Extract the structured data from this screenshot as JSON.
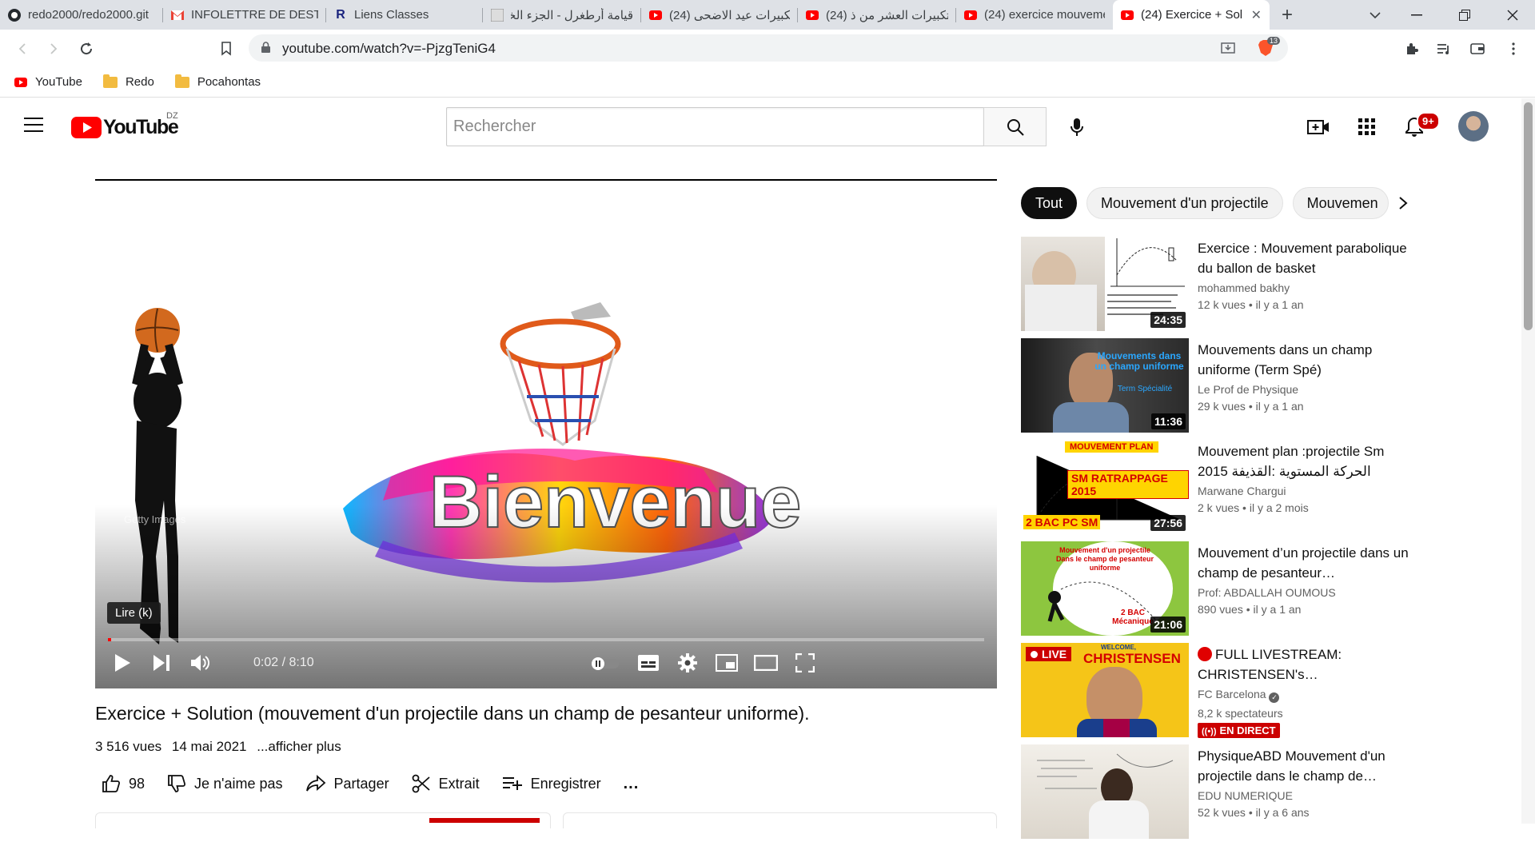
{
  "browser": {
    "tabs": [
      {
        "title": "redo2000/redo2000.git",
        "icon": "github-icon"
      },
      {
        "title": "INFOLETTRE DE DESTIN",
        "icon": "gmail-icon"
      },
      {
        "title": "Liens Classes",
        "icon": "r-icon"
      },
      {
        "title": "قيامة أرطغرل - الجزء الخا",
        "icon": "site-icon"
      },
      {
        "title": "(24) تكبيرات عيد الاضحى",
        "icon": "youtube-icon"
      },
      {
        "title": "(24) تكبيرات العشر من ذ",
        "icon": "youtube-icon"
      },
      {
        "title": "(24) exercice mouveme",
        "icon": "youtube-icon"
      },
      {
        "title": "(24) Exercice + Sol",
        "icon": "youtube-icon"
      }
    ],
    "url": "youtube.com/watch?v=-PjzgTeniG4",
    "brave_badge": "13",
    "bookmarks": [
      {
        "label": "YouTube",
        "icon": "youtube-icon"
      },
      {
        "label": "Redo",
        "icon": "folder-icon"
      },
      {
        "label": "Pocahontas",
        "icon": "folder-icon"
      }
    ]
  },
  "header": {
    "logo_text": "YouTube",
    "country": "DZ",
    "search_placeholder": "Rechercher",
    "notif_count": "9+"
  },
  "player": {
    "thumbnail_text": "Bienvenue",
    "watermark": "Getty Images",
    "tooltip": "Lire (k)",
    "time": "0:02 / 8:10",
    "progress_fraction": 0.004
  },
  "video": {
    "title": "Exercice + Solution (mouvement d'un projectile dans un champ de pesanteur uniforme).",
    "views": "3 516 vues",
    "date": "14 mai 2021",
    "more": "...afficher plus",
    "likes": "98",
    "dislike_label": "Je n'aime pas",
    "share_label": "Partager",
    "clip_label": "Extrait",
    "save_label": "Enregistrer",
    "more_actions": "..."
  },
  "chips": [
    "Tout",
    "Mouvement d'un projectile",
    "Mouvemen"
  ],
  "related": [
    {
      "title": "Exercice : Mouvement parabolique du ballon de basket",
      "channel": "mohammed bakhy",
      "views": "12 k vues",
      "age": "il y a 1 an",
      "duration": "24:35"
    },
    {
      "title": "Mouvements dans un champ uniforme (Term Spé)",
      "channel": "Le Prof de Physique",
      "views": "29 k vues",
      "age": "il y a 1 an",
      "duration": "11:36",
      "thumb_text": "Mouvements dans un champ uniforme",
      "thumb_sub": "Term Spécialité"
    },
    {
      "title": "Mouvement plan :projectile Sm 2015 الحركة المستوية :القذيفة",
      "channel": "Marwane Chargui",
      "views": "2 k vues",
      "age": "il y a 2 mois",
      "duration": "27:56",
      "thumb_top": "MOUVEMENT PLAN",
      "thumb_mid": "SM RATRAPPAGE 2015",
      "thumb_bottom": "2 BAC PC SM"
    },
    {
      "title": "Mouvement d’un projectile dans un champ de pesanteur…",
      "channel": "Prof: ABDALLAH OUMOUS",
      "views": "890 vues",
      "age": "il y a 1 an",
      "duration": "21:06",
      "thumb_text": "Mouvement d'un projectile Dans le champ de pesanteur uniforme",
      "thumb_sub": "2 BAC Mécanique"
    },
    {
      "title": "FULL LIVESTREAM: CHRISTENSEN's…",
      "channel": "FC Barcelona",
      "viewers": "8,2 k spectateurs",
      "live_label": "EN DIRECT",
      "thumb_live": "LIVE",
      "thumb_welcome": "WELCOME,",
      "thumb_name": "CHRISTENSEN"
    },
    {
      "title": "PhysiqueABD Mouvement d'un projectile dans le champ de…",
      "channel": "EDU NUMERIQUE",
      "views": "52 k vues",
      "age": "il y a 6 ans"
    }
  ]
}
